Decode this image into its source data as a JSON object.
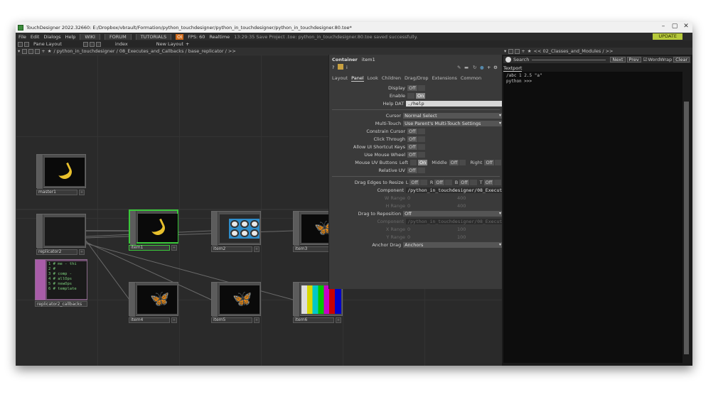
{
  "window": {
    "title": "TouchDesigner 2022.32660: E:/Dropbox/vbrault/Formation/python_touchdesigner/python_in_touchdesigner/python_in_touchdesigner.80.toe*",
    "min": "–",
    "max": "▢",
    "close": "✕"
  },
  "menubar": {
    "file": "File",
    "edit": "Edit",
    "dialogs": "Dialogs",
    "help": "Help",
    "wiki": "WIKI",
    "forum": "FORUM",
    "tutorials": "TUTORIALS",
    "oi": "OI",
    "fps_label": "FPS:",
    "fps_value": "60",
    "realtime": "Realtime",
    "status": "13:29:35 Save Project .toe: python_in_touchdesigner.80.toe saved successfully.",
    "update": "UPDATE"
  },
  "layoutbar": {
    "pane_layout": "Pane Layout",
    "index": "index",
    "new_layout": "New Layout"
  },
  "pathbar": {
    "path": "/ python_in_touchdesigner / 08_Executes_and_Callbacks / base_replicator / >>"
  },
  "pathbar2": {
    "path": "<< 02_Classes_and_Modules / >>"
  },
  "nodes": {
    "master1": "master1",
    "replicator2": "replicator2",
    "callbacks": "replicator2_callbacks",
    "item1": "item1",
    "item2": "item2",
    "item3": "item3",
    "item4": "item4",
    "item5": "item5",
    "item6": "item6"
  },
  "dat_code": "1 # me - thi\n2 # \n3 # comp - \n4 # allOps\n5 # newOps\n6 # template",
  "panel": {
    "type": "Container",
    "name": "item1",
    "tabs": [
      "Layout",
      "Panel",
      "Look",
      "Children",
      "Drag/Drop",
      "Extensions",
      "Common"
    ],
    "display": "Display",
    "enable": "Enable",
    "help_dat": "Help DAT",
    "help_dat_value": "./help",
    "cursor": "Cursor",
    "cursor_value": "Normal Select",
    "multitouch": "Multi-Touch",
    "multitouch_value": "Use Parent's Multi-Touch Settings",
    "constrain": "Constrain Cursor",
    "click_through": "Click Through",
    "allow_ui": "Allow UI Shortcut Keys",
    "mouse_wheel": "Use Mouse Wheel",
    "mouse_uv": "Mouse UV Buttons",
    "left": "Left",
    "middle": "Middle",
    "right": "Right",
    "relative_uv": "Relative UV",
    "drag_edges": "Drag Edges to Resize",
    "l": "L",
    "r": "R",
    "b": "B",
    "t": "T",
    "component": "Component",
    "component_value": "/python_in_touchdesigner/08_Executes",
    "w_range": "W Range",
    "h_range": "H Range",
    "range_0": "0",
    "range_400": "400",
    "drag_reposition": "Drag to Reposition",
    "drag_reposition_value": "Off",
    "component2_value": "/python_in_touchdesigner/08_Executes",
    "x_range": "X Range",
    "y_range": "Y Range",
    "range_100": "100",
    "anchor_drag": "Anchor Drag",
    "anchor_drag_value": "Anchors",
    "off": "Off",
    "on": "On"
  },
  "textport": {
    "search": "Search",
    "next": "Next",
    "prev": "Prev",
    "wordwrap": "WordWrap",
    "clear": "Clear",
    "tab": "Textport",
    "output": "/abc 1 2.5 \"a\"\npython >>>"
  }
}
